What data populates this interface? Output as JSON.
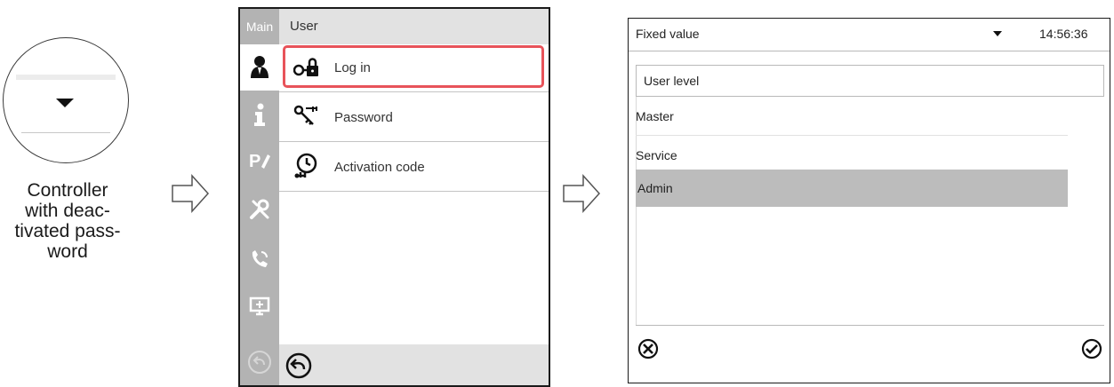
{
  "caption": {
    "line1": "Controller",
    "line2": "with deac-",
    "line3": "tivated pass-",
    "line4": "word"
  },
  "screen1": {
    "sidebar_title": "Main",
    "header_title": "User",
    "items": [
      {
        "label": "Log in",
        "icon": "login-lock-icon"
      },
      {
        "label": "Password",
        "icon": "key-icon"
      },
      {
        "label": "Activation code",
        "icon": "activation-code-icon"
      }
    ],
    "sidebar_icons": [
      "user-icon",
      "info-icon",
      "program-edit-icon",
      "tools-icon",
      "service-phone-icon",
      "display-settings-icon",
      "back-icon"
    ],
    "colors": {
      "highlight": "#e8535a",
      "sidebar": "#b3b3b3",
      "header": "#e2e2e2"
    }
  },
  "screen2": {
    "mode": "Fixed value",
    "time": "14:56:36",
    "list_title": "User level",
    "options": [
      "Master",
      "Service",
      "Admin"
    ],
    "selected": "Admin",
    "cancel_icon": "cancel-icon",
    "confirm_icon": "confirm-icon",
    "colors": {
      "selected_row": "#bcbcbc"
    }
  }
}
